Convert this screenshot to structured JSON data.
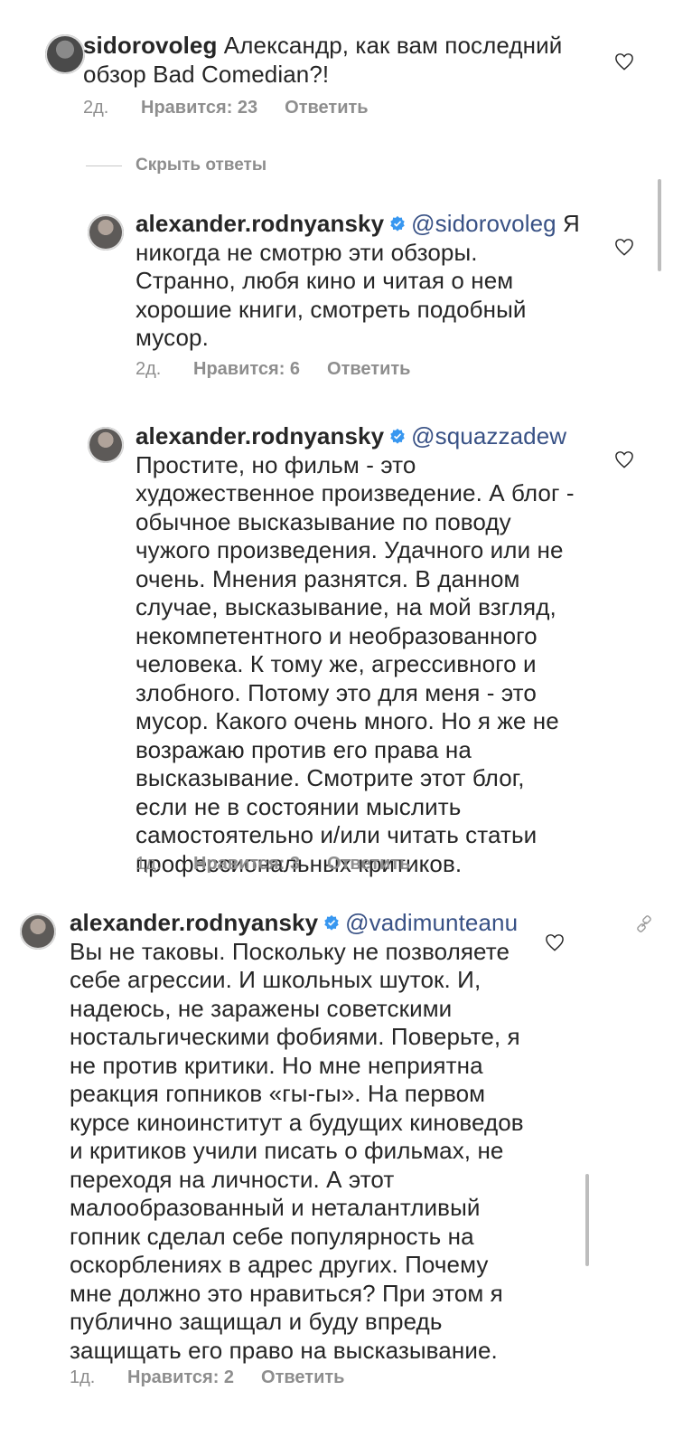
{
  "comments": [
    {
      "username": "sidorovoleg",
      "text": " Александр, как вам последний обзор Bad Comedian?!",
      "age": "2д.",
      "likes": "Нравится: 23",
      "reply": "Ответить"
    }
  ],
  "hide_replies": "Скрыть ответы",
  "replies": [
    {
      "username": "alexander.rodnyansky",
      "mention": "@sidorovoleg",
      "text": "Я никогда не смотрю эти обзоры. Странно, любя кино и читая о нем хорошие книги, смотреть подобный мусор.",
      "age": "2д.",
      "likes": "Нравится: 6",
      "reply": "Ответить"
    },
    {
      "username": "alexander.rodnyansky",
      "mention": "@squazzadew",
      "text": "Простите, но фильм - это художественное произведение. А блог - обычное высказывание по поводу чужого произведения. Удачного или не очень. Мнения разнятся. В данном случае, высказывание, на мой взгляд, некомпетентного и необразованного человека. К тому же, агрессивного и злобного. Потому это для меня - это мусор. Какого очень много.  Но я же не возражаю против его права на высказывание. Смотрите этот блог, если не в состоянии мыслить самостоятельно и/или читать статьи профессиональных критиков.",
      "age": "1д.",
      "likes": "Нравится: 3",
      "reply": "Ответить"
    }
  ],
  "last_comment": {
    "username": "alexander.rodnyansky",
    "mention": "@vadimunteanu",
    "text": "Вы не таковы. Поскольку не позволяете себе агрессии. И школьных шуток. И, надеюсь, не заражены советскими ностальгическими фобиями. Поверьте, я не против критики. Но мне неприятна реакция гопников «гы-гы». На первом курсе киноинститут а будущих киноведов и критиков учили писать о фильмах, не переходя на личности. А этот малообразованный и неталантливый гопник сделал себе популярность на оскорблениях в адрес других. Почему мне должно это нравиться? При этом я публично защищал и буду впредь защищать его право на высказывание.",
    "age": "1д.",
    "likes": "Нравится: 2",
    "reply": "Ответить"
  },
  "icons": {
    "heart": "heart-outline-icon",
    "verified": "verified-badge-icon",
    "link": "link-icon"
  },
  "colors": {
    "text": "#262626",
    "meta": "#8e8e8e",
    "mention": "#385185",
    "verified": "#3897f0"
  }
}
